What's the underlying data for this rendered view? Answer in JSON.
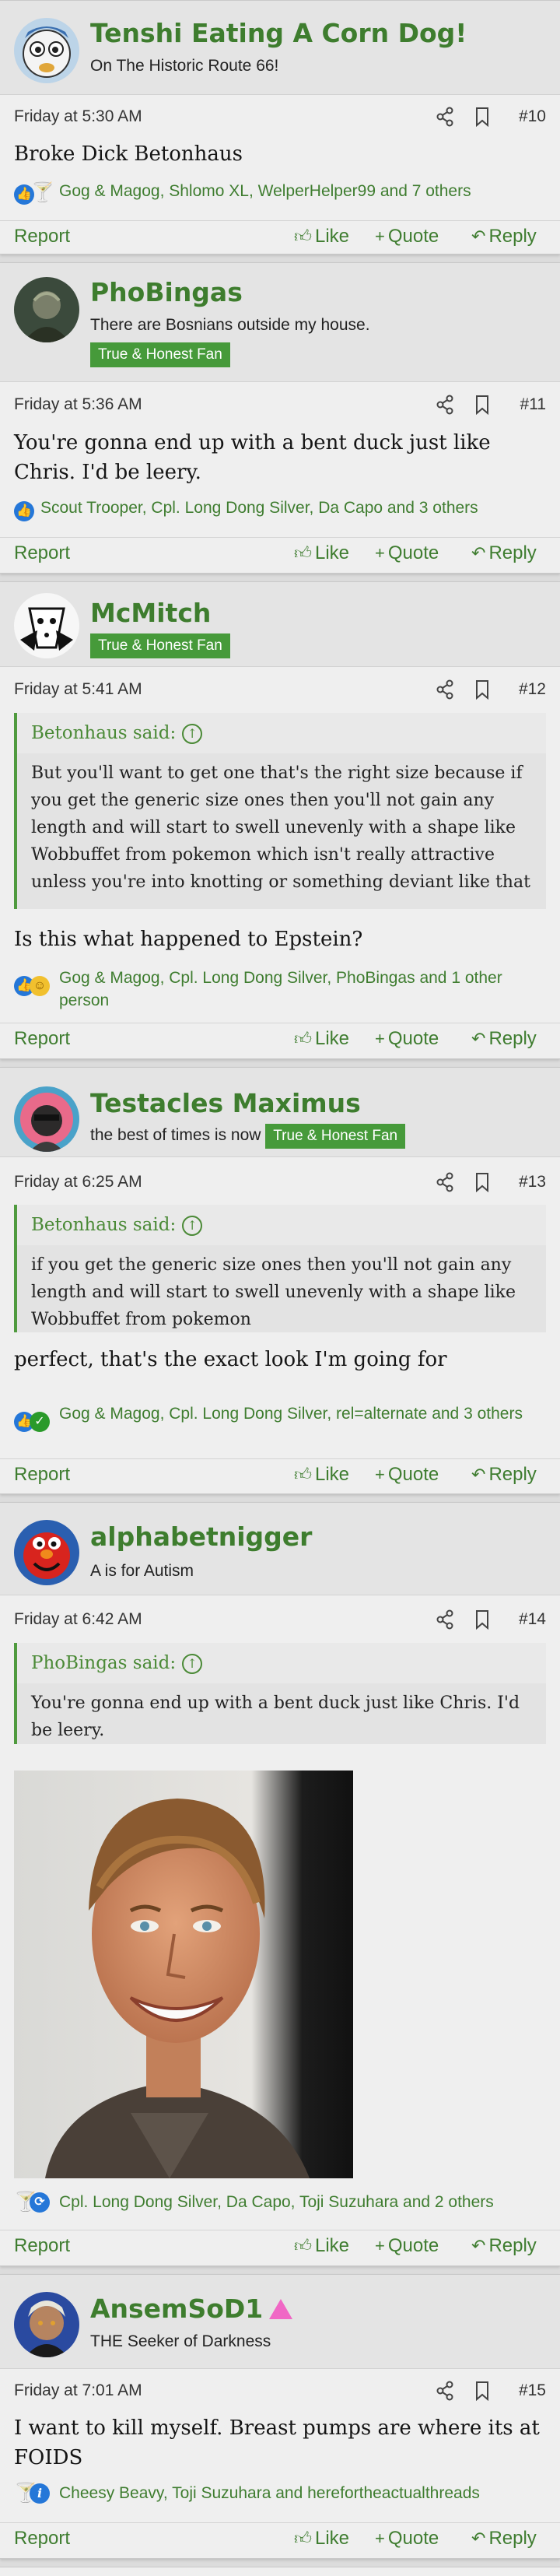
{
  "ui": {
    "like": "Like",
    "quote": "Quote",
    "reply": "Reply",
    "report": "Report",
    "said_suffix": "said:"
  },
  "posts": [
    {
      "author": "Tenshi Eating A Corn Dog!",
      "user_title": "On The Historic Route 66!",
      "date": "Friday at 5:30 AM",
      "number": "#10",
      "body": "Broke Dick Betonhaus",
      "reactions": "Gog & Magog, Shlomo XL, WelperHelper99 and 7 others",
      "reaction_icons": [
        "like-icon",
        "martini-icon"
      ]
    },
    {
      "author": "PhoBingas",
      "user_title": "There are Bosnians outside my house.",
      "badge": "True & Honest Fan",
      "date": "Friday at 5:36 AM",
      "number": "#11",
      "body": "You're gonna end up with a bent duck just like Chris. I'd be leery.",
      "reactions": "Scout Trooper, Cpl. Long Dong Silver, Da Capo and 3 others",
      "reaction_icons": [
        "like-icon"
      ]
    },
    {
      "author": "McMitch",
      "badge": "True & Honest Fan",
      "date": "Friday at 5:41 AM",
      "number": "#12",
      "quote_author": "Betonhaus",
      "quote_text": "But you'll want to get one that's the right size because if you get the generic size ones then you'll not gain any length and will start to swell unevenly with a shape like Wobbuffet from pokemon which isn't really attractive unless you're into knotting or something deviant like that",
      "body": "Is this what happened to Epstein?",
      "reactions": "Gog & Magog, Cpl. Long Dong Silver, PhoBingas and 1 other person",
      "reaction_icons": [
        "like-icon",
        "haha-icon"
      ]
    },
    {
      "author": "Testacles Maximus",
      "user_title": "the best of times is now",
      "badge": "True & Honest Fan",
      "date": "Friday at 6:25 AM",
      "number": "#13",
      "quote_author": "Betonhaus",
      "quote_text": "if you get the generic size ones then you'll not gain any length and will start to swell unevenly with a shape like Wobbuffet from pokemon",
      "body": "perfect, that's the exact look I'm going for",
      "reactions": "Gog & Magog, Cpl. Long Dong Silver, rel=alternate and 3 others",
      "reaction_icons": [
        "like-icon",
        "check-icon"
      ]
    },
    {
      "author": "alphabetnigger",
      "user_title": "A is for Autism",
      "date": "Friday at 6:42 AM",
      "number": "#14",
      "quote_author": "PhoBingas",
      "quote_text": "You're gonna end up with a bent duck just like Chris. I'd be leery.",
      "reactions": "Cpl. Long Dong Silver, Da Capo, Toji Suzuhara and 2 others",
      "reaction_icons": [
        "martini-icon",
        "sync-icon"
      ]
    },
    {
      "author": "AnsemSoD1",
      "user_title": "THE Seeker of Darkness",
      "date": "Friday at 7:01 AM",
      "number": "#15",
      "body": "I want to kill myself. Breast pumps are where its at FOIDS",
      "reactions": "Cheesy Beavy, Toji Suzuhara and herefortheactualthreads",
      "reaction_icons": [
        "martini-icon",
        "info-icon"
      ]
    }
  ],
  "colors": {
    "accent": "#3e7d2e",
    "badge": "#469a3a",
    "post_bg": "#efefef",
    "quote_border": "#4f9a3e"
  }
}
